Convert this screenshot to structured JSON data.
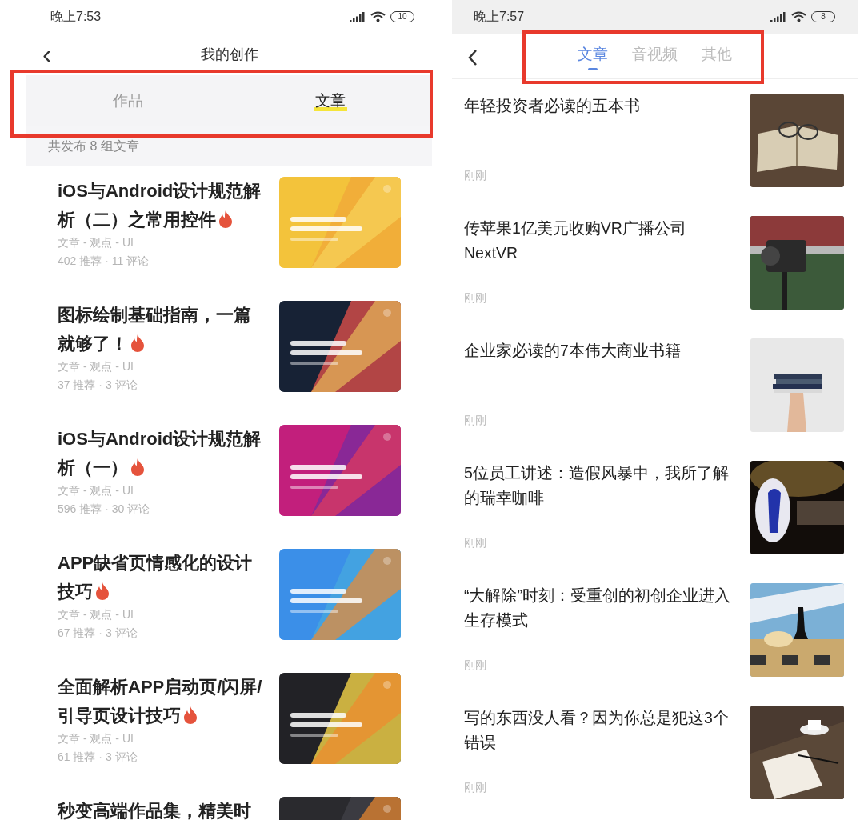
{
  "left_screen": {
    "status_bar": {
      "time": "晚上7:53",
      "battery": "10"
    },
    "title": "我的创作",
    "back": "‹",
    "tabs": [
      {
        "label": "作品",
        "selected": false
      },
      {
        "label": "文章",
        "selected": true
      }
    ],
    "summary": "共发布 8 组文章",
    "articles": [
      {
        "title": "iOS与Android设计规范解析（二）之常用控件",
        "hot": true,
        "tags": "文章 - 观点 - UI",
        "stats": "402 推荐 · 11 评论"
      },
      {
        "title": "图标绘制基础指南，一篇就够了！",
        "hot": true,
        "tags": "文章 - 观点 - UI",
        "stats": "37 推荐 · 3 评论"
      },
      {
        "title": "iOS与Android设计规范解析（一）",
        "hot": true,
        "tags": "文章 - 观点 - UI",
        "stats": "596 推荐 · 30 评论"
      },
      {
        "title": "APP缺省页情感化的设计技巧",
        "hot": true,
        "tags": "文章 - 观点 - UI",
        "stats": "67 推荐 · 3 评论"
      },
      {
        "title": "全面解析APP启动页/闪屏/引导页设计技巧",
        "hot": true,
        "tags": "文章 - 观点 - UI",
        "stats": "61 推荐 · 3 评论"
      },
      {
        "title": "秒变高端作品集，精美时",
        "hot": false
      }
    ]
  },
  "right_screen": {
    "status_bar": {
      "time": "晚上7:57",
      "battery": "8"
    },
    "tabs": [
      {
        "label": "文章",
        "selected": true
      },
      {
        "label": "音视频",
        "selected": false
      },
      {
        "label": "其他",
        "selected": false
      }
    ],
    "articles": [
      {
        "title": "年轻投资者必读的五本书",
        "time": "刚刚"
      },
      {
        "title": "传苹果1亿美元收购VR广播公司NextVR",
        "time": "刚刚"
      },
      {
        "title": "企业家必读的7本伟大商业书籍",
        "time": "刚刚"
      },
      {
        "title": "5位员工讲述：造假风暴中，我所了解的瑞幸咖啡",
        "time": "刚刚"
      },
      {
        "title": "“大解除”时刻：受重创的初创企业进入生存模式",
        "time": "刚刚"
      },
      {
        "title": "写的东西没人看？因为你总是犯这3个错误",
        "time": "刚刚"
      }
    ]
  }
}
